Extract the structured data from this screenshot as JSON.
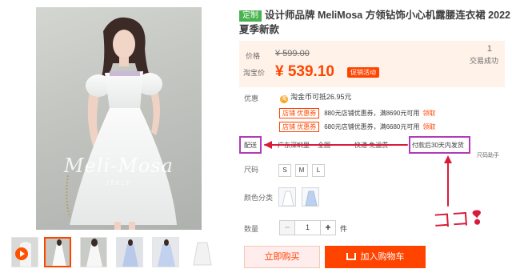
{
  "product": {
    "custom_tag": "定制",
    "title": "设计师品牌 MeliMosa 方领钻饰小心机露腰连衣裙 2022夏季新款"
  },
  "gallery": {
    "watermark": "Meli-Mosa",
    "watermark_sub": "ITALY",
    "thumbnails": [
      "video",
      "dress-front",
      "dress-back",
      "dress-blue",
      "dress-blue-2",
      "dress-flat"
    ]
  },
  "price": {
    "label": "价格",
    "original": "¥ 599.00",
    "taobao_label": "淘宝价",
    "current": "¥ 539.10",
    "promo_tag": "促销活动",
    "sales_count": "1",
    "sales_label": "交易成功"
  },
  "discount": {
    "label": "优惠",
    "coin_icon": "淘",
    "coin_text": "淘金币可抵26.95元",
    "coupons": [
      {
        "tag": "店铺  优惠券",
        "text": "880元店铺优惠券，满8690元可用",
        "link": "领取"
      },
      {
        "tag": "店铺  优惠券",
        "text": "680元店铺优惠券，满6680元可用",
        "link": "领取"
      }
    ]
  },
  "shipping": {
    "label": "配送",
    "origin": "广东深圳里",
    "dest": "全国",
    "fee": "快递 免运费",
    "delivery": "付款后30天内发货",
    "size_guide": "尺码助手"
  },
  "size": {
    "label": "尺码",
    "options": [
      "S",
      "M",
      "L"
    ]
  },
  "color": {
    "label": "颜色分类"
  },
  "quantity": {
    "label": "数量",
    "minus": "−",
    "value": "1",
    "plus": "+",
    "unit": "件"
  },
  "actions": {
    "buy_now": "立即购买",
    "add_to_cart": "加入购物车"
  },
  "annotation": {
    "text": "ココ❢",
    "color": "#d91b3a",
    "highlight_color": "#b03cb8"
  },
  "theme": {
    "accent": "#ff4400",
    "price_bg": "#fff2e8"
  }
}
